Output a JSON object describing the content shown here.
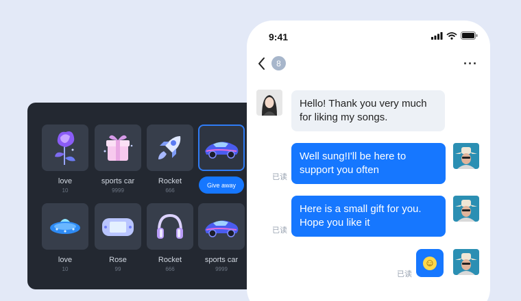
{
  "status": {
    "time": "9:41"
  },
  "nav": {
    "badge": "8",
    "more": "···"
  },
  "messages": [
    {
      "text": "Hello! Thank you very much for liking my songs."
    },
    {
      "text": "Well sung!I'll be here to support you often",
      "read": "已读"
    },
    {
      "text": "Here is a small gift for you. Hope you like it",
      "read": "已读"
    },
    {
      "emoji": "☺",
      "read": "已读"
    }
  ],
  "gifts": [
    {
      "name": "love",
      "price": "10",
      "icon": "rose-icon"
    },
    {
      "name": "sports car",
      "price": "9999",
      "icon": "gift-box-icon"
    },
    {
      "name": "Rocket",
      "price": "666",
      "icon": "rocket-icon"
    },
    {
      "name": "",
      "price": "",
      "icon": "sports-car-icon",
      "selected": true,
      "button": "Give away"
    },
    {
      "name": "love",
      "price": "10",
      "icon": "ufo-icon"
    },
    {
      "name": "Rose",
      "price": "99",
      "icon": "game-console-icon"
    },
    {
      "name": "Rocket",
      "price": "666",
      "icon": "headphones-icon"
    },
    {
      "name": "sports car",
      "price": "9999",
      "icon": "sports-car-icon"
    }
  ],
  "colors": {
    "accent": "#1677ff",
    "panel": "#232831",
    "tile": "#373e4b",
    "background": "#e3e9f7"
  }
}
